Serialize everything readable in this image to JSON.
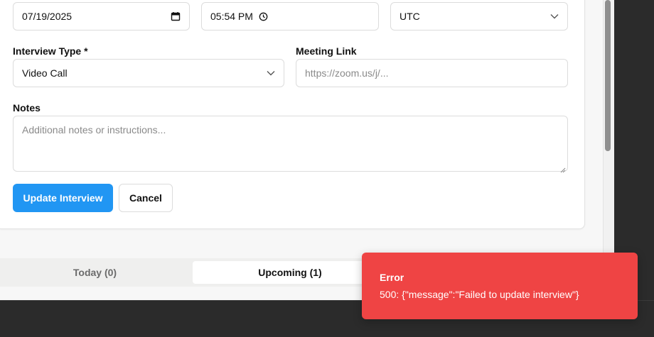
{
  "schedule": {
    "date_value": "07/19/2025",
    "time_value": "05:54 PM",
    "timezone_value": "UTC"
  },
  "interview_type": {
    "label": "Interview Type *",
    "value": "Video Call"
  },
  "meeting_link": {
    "label": "Meeting Link",
    "placeholder": "https://zoom.us/j/..."
  },
  "notes": {
    "label": "Notes",
    "placeholder": "Additional notes or instructions..."
  },
  "actions": {
    "update_label": "Update Interview",
    "cancel_label": "Cancel"
  },
  "tabs": [
    {
      "label": "Today (0)",
      "active": false
    },
    {
      "label": "Upcoming (1)",
      "active": true
    }
  ],
  "toast": {
    "title": "Error",
    "message": "500: {\"message\":\"Failed to update interview\"}"
  },
  "colors": {
    "primary": "#2196f3",
    "error": "#ef4444"
  },
  "icons": {
    "date": "calendar-icon",
    "time": "clock-icon",
    "dropdown": "chevron-down-icon"
  }
}
